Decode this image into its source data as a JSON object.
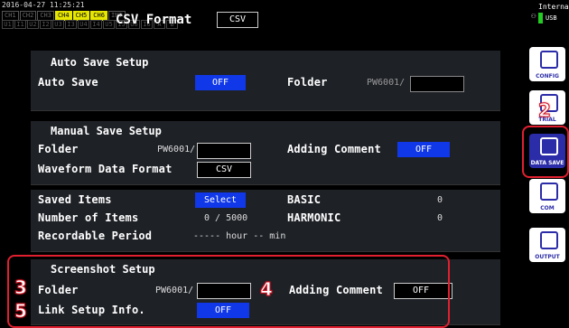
{
  "status": {
    "datetime": "2016-04-27 11:25:21",
    "channels": [
      "CH1",
      "CH2",
      "CH3",
      "CH4",
      "CH5",
      "CH6",
      "INT"
    ],
    "channels_active": [
      false,
      false,
      false,
      true,
      true,
      true,
      false
    ],
    "sub_channels": [
      "U1",
      "I1",
      "U2",
      "I2",
      "U3",
      "I3",
      "U4",
      "I4",
      "U5",
      "I5",
      "U6",
      "I6",
      "A",
      "B"
    ],
    "title": "CSV Format",
    "format_value": "CSV",
    "media_label": "Internal",
    "usb_label": "USB"
  },
  "auto_save": {
    "heading": "Auto Save Setup",
    "auto_save_label": "Auto Save",
    "auto_save_value": "OFF",
    "folder_label": "Folder",
    "folder_value": "PW6001/"
  },
  "manual_save": {
    "heading": "Manual Save Setup",
    "folder_label": "Folder",
    "folder_value": "PW6001/",
    "comment_label": "Adding Comment",
    "comment_value": "OFF",
    "waveform_label": "Waveform Data Format",
    "waveform_value": "CSV"
  },
  "saved_items": {
    "label": "Saved Items",
    "select_label": "Select",
    "number_label": "Number of Items",
    "number_value": "0 / 5000",
    "recordable_label": "Recordable Period",
    "recordable_value": "----- hour -- min",
    "basic_label": "BASIC",
    "basic_value": "0",
    "harmonic_label": "HARMONIC",
    "harmonic_value": "0"
  },
  "screenshot": {
    "heading": "Screenshot Setup",
    "folder_label": "Folder",
    "folder_value": "PW6001/",
    "comment_label": "Adding Comment",
    "comment_value": "OFF",
    "link_label": "Link Setup Info.",
    "link_value": "OFF"
  },
  "side_menu": [
    {
      "label": "CONFIG",
      "icon": "wrench-icon"
    },
    {
      "label": "TRIAL",
      "icon": "trigger-icon"
    },
    {
      "label": "DATA SAVE",
      "icon": "usb-save-icon"
    },
    {
      "label": "COM",
      "icon": "arrows-icon"
    },
    {
      "label": "OUTPUT",
      "icon": "output-icon"
    }
  ],
  "callouts": [
    "2",
    "3",
    "4",
    "5"
  ],
  "colors": {
    "accent_blue": "#1038e8",
    "callout_red": "#e02030",
    "active_menu": "#2b2ca8"
  }
}
